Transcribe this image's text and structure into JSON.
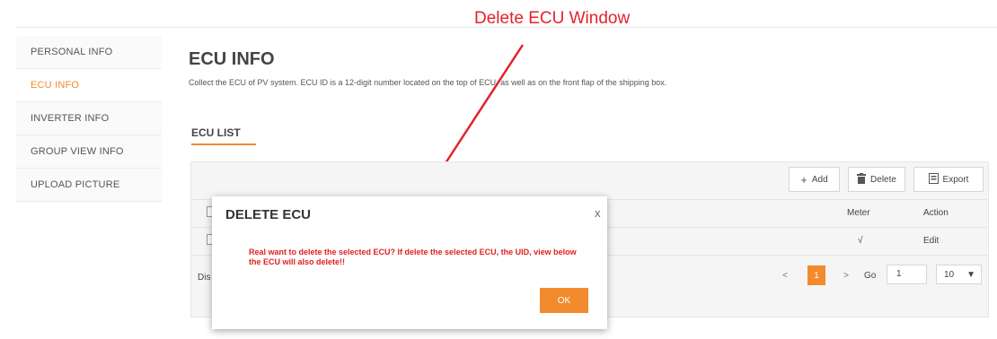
{
  "annotation": {
    "text": "Delete ECU Window",
    "color": "#e5212b"
  },
  "sidebar": {
    "items": [
      {
        "label": "PERSONAL INFO"
      },
      {
        "label": "ECU INFO",
        "active": true
      },
      {
        "label": "INVERTER INFO"
      },
      {
        "label": "GROUP VIEW INFO"
      },
      {
        "label": "UPLOAD PICTURE"
      }
    ]
  },
  "main": {
    "title": "ECU INFO",
    "description": "Collect the ECU of PV system. ECU ID is a 12-digit number located on the top of ECU, as well as on the front flap of the shipping box.",
    "tab": "ECU LIST",
    "toolbar": {
      "add_label": "Add",
      "delete_label": "Delete",
      "export_label": "Export"
    },
    "table": {
      "columns": [
        "Meter",
        "Action"
      ],
      "rows": [
        {
          "meter": "√",
          "action": "Edit"
        }
      ]
    },
    "pagination": {
      "display_text": "Dis",
      "current_page": "1",
      "go_label": "Go",
      "go_value": "1",
      "page_size": "10"
    }
  },
  "modal": {
    "title": "DELETE ECU",
    "close_label": "X",
    "message": "Real want to delete the selected ECU? If delete the selected ECU, the UID, view below the ECU will also delete!!",
    "ok_label": "OK"
  },
  "colors": {
    "accent": "#f28a2e",
    "alert": "#e02020"
  }
}
